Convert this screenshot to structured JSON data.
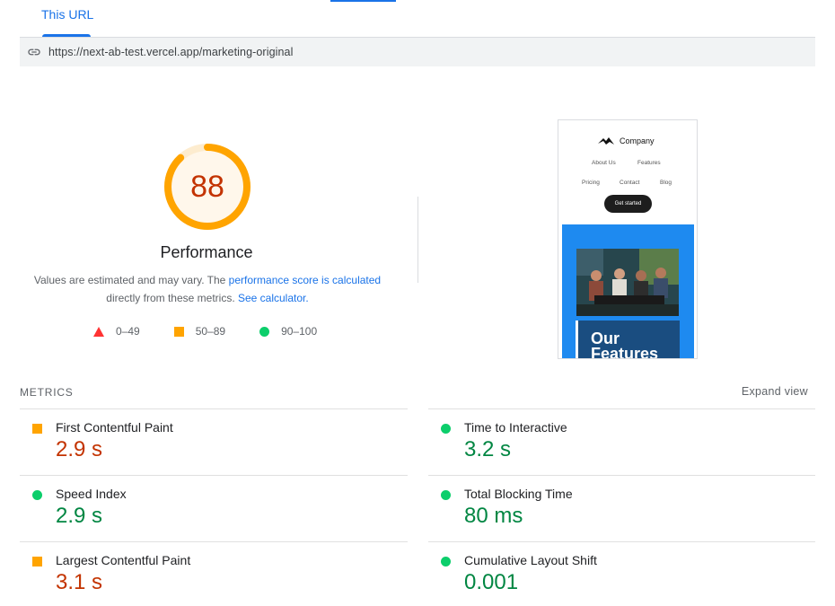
{
  "tabs": {
    "active_label": "This URL"
  },
  "url_bar": {
    "url": "https://next-ab-test.vercel.app/marketing-original",
    "icon": "link-icon"
  },
  "performance": {
    "score": "88",
    "score_value": 88,
    "title": "Performance",
    "desc_prefix": "Values are estimated and may vary. The ",
    "desc_link1": "performance score is calculated",
    "desc_middle": " directly from these metrics. ",
    "desc_link2": "See calculator.",
    "colors": {
      "average": "#ffa400",
      "fail": "#ff3333",
      "pass": "#0cce6b",
      "score_text": "#c33300"
    }
  },
  "legend": [
    {
      "icon": "triangle-icon",
      "label": "0–49"
    },
    {
      "icon": "square-icon",
      "label": "50–89"
    },
    {
      "icon": "circle-icon",
      "label": "90–100"
    }
  ],
  "screenshot": {
    "brand": "Company",
    "nav": [
      "About Us",
      "Features",
      "Pricing",
      "Contact",
      "Blog"
    ],
    "cta": "Get started",
    "card_line1": "Our",
    "card_line2": "Features"
  },
  "metrics": {
    "heading": "METRICS",
    "expand_label": "Expand view",
    "items": [
      {
        "label": "First Contentful Paint",
        "value": "2.9 s",
        "status": "average"
      },
      {
        "label": "Time to Interactive",
        "value": "3.2 s",
        "status": "pass"
      },
      {
        "label": "Speed Index",
        "value": "2.9 s",
        "status": "pass"
      },
      {
        "label": "Total Blocking Time",
        "value": "80 ms",
        "status": "pass"
      },
      {
        "label": "Largest Contentful Paint",
        "value": "3.1 s",
        "status": "average"
      },
      {
        "label": "Cumulative Layout Shift",
        "value": "0.001",
        "status": "pass"
      }
    ]
  }
}
